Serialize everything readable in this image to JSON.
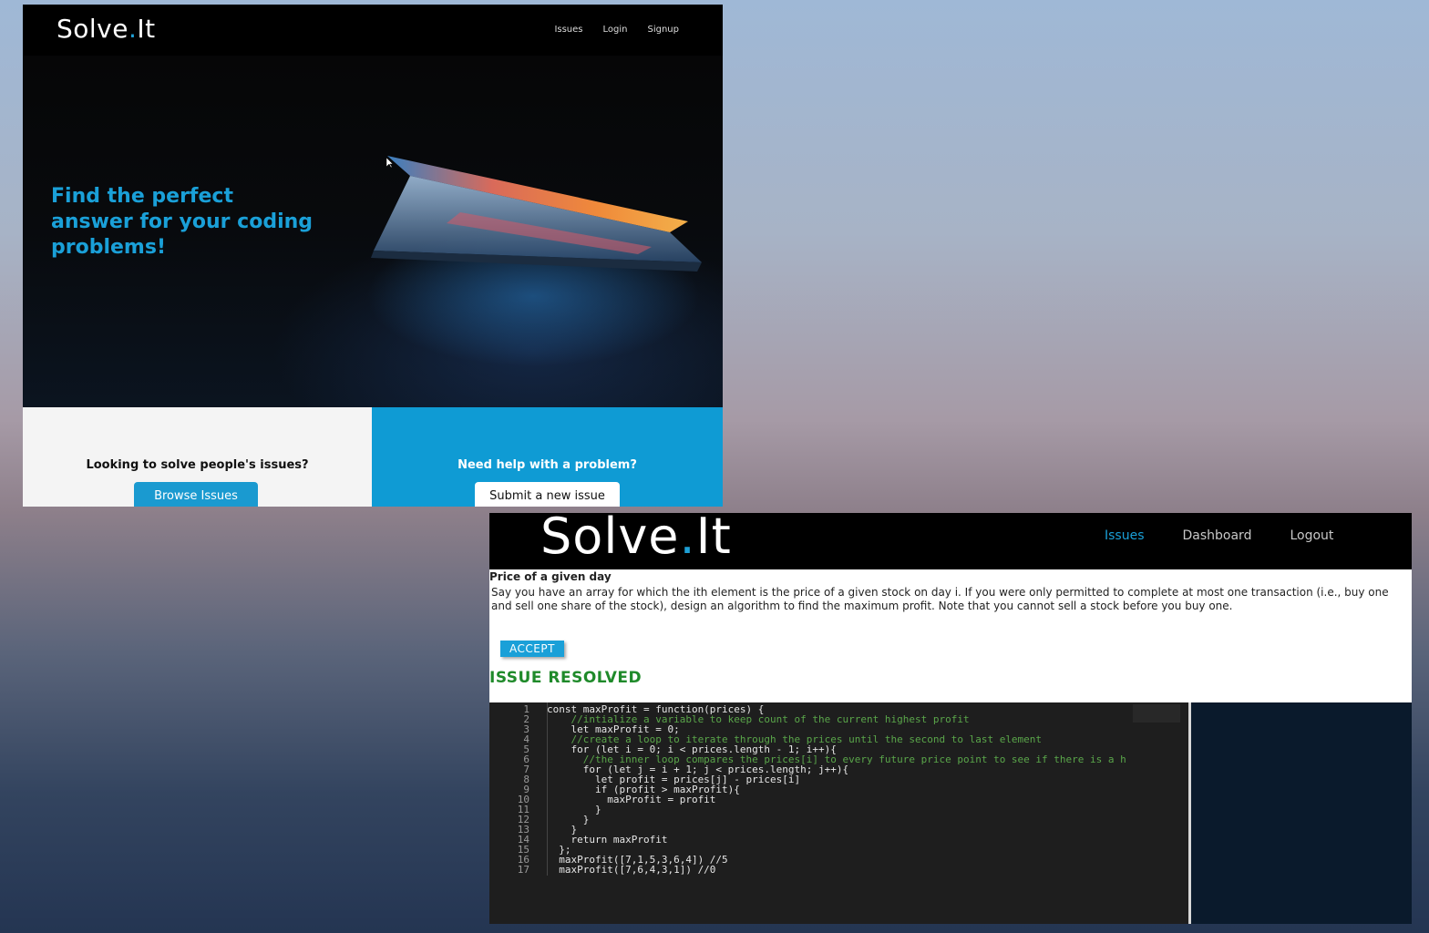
{
  "screen1": {
    "logo": {
      "main": "Solve",
      "dot": ".",
      "tail": "It"
    },
    "nav": [
      "Issues",
      "Login",
      "Signup"
    ],
    "tagline": "Find the perfect answer for your coding problems!",
    "left_panel": {
      "title": "Looking to solve people's issues?",
      "button": "Browse Issues"
    },
    "right_panel": {
      "title": "Need help with a problem?",
      "button": "Submit a new issue"
    }
  },
  "screen2": {
    "logo": {
      "main": "Solve",
      "dot": ".",
      "tail": "It"
    },
    "nav": {
      "issues": "Issues",
      "dashboard": "Dashboard",
      "logout": "Logout"
    },
    "issue": {
      "title": "Price of a given day",
      "body": "Say you have an array for which the ith element is the price of a given stock on day i. If you were only permitted to complete at most one transaction (i.e., buy one and sell one share of the stock), design an algorithm to find the maximum profit. Note that you cannot sell a stock before you buy one.",
      "accept_button": "ACCEPT",
      "status": "ISSUE RESOLVED"
    },
    "code_lines": [
      {
        "n": "1",
        "text": "const maxProfit = function(prices) {",
        "color": "#e6e6e6"
      },
      {
        "n": "2",
        "text": "    //intialize a variable to keep count of the current highest profit",
        "color": "#5aa64a"
      },
      {
        "n": "3",
        "text": "    let maxProfit = 0;",
        "color": "#e6e6e6"
      },
      {
        "n": "4",
        "text": "    //create a loop to iterate through the prices until the second to last element",
        "color": "#5aa64a"
      },
      {
        "n": "5",
        "text": "    for (let i = 0; i < prices.length - 1; i++){",
        "color": "#e6e6e6"
      },
      {
        "n": "6",
        "text": "      //the inner loop compares the prices[i] to every future price point to see if there is a h",
        "color": "#5aa64a"
      },
      {
        "n": "7",
        "text": "      for (let j = i + 1; j < prices.length; j++){",
        "color": "#e6e6e6"
      },
      {
        "n": "8",
        "text": "        let profit = prices[j] - prices[i]",
        "color": "#e6e6e6"
      },
      {
        "n": "9",
        "text": "        if (profit > maxProfit){",
        "color": "#e6e6e6"
      },
      {
        "n": "10",
        "text": "          maxProfit = profit",
        "color": "#e6e6e6"
      },
      {
        "n": "11",
        "text": "        }",
        "color": "#e6e6e6"
      },
      {
        "n": "12",
        "text": "      }",
        "color": "#e6e6e6"
      },
      {
        "n": "13",
        "text": "    }",
        "color": "#e6e6e6"
      },
      {
        "n": "14",
        "text": "    return maxProfit",
        "color": "#e6e6e6"
      },
      {
        "n": "15",
        "text": "  };",
        "color": "#e6e6e6"
      },
      {
        "n": "16",
        "text": "  maxProfit([7,1,5,3,6,4]) //5",
        "color": "#e6e6e6"
      },
      {
        "n": "17",
        "text": "  maxProfit([7,6,4,3,1]) //0",
        "color": "#e6e6e6"
      }
    ]
  },
  "colors": {
    "accent": "#1aa0d8",
    "resolved": "#1f8a2a",
    "editor_bg": "#1e1e1e"
  }
}
